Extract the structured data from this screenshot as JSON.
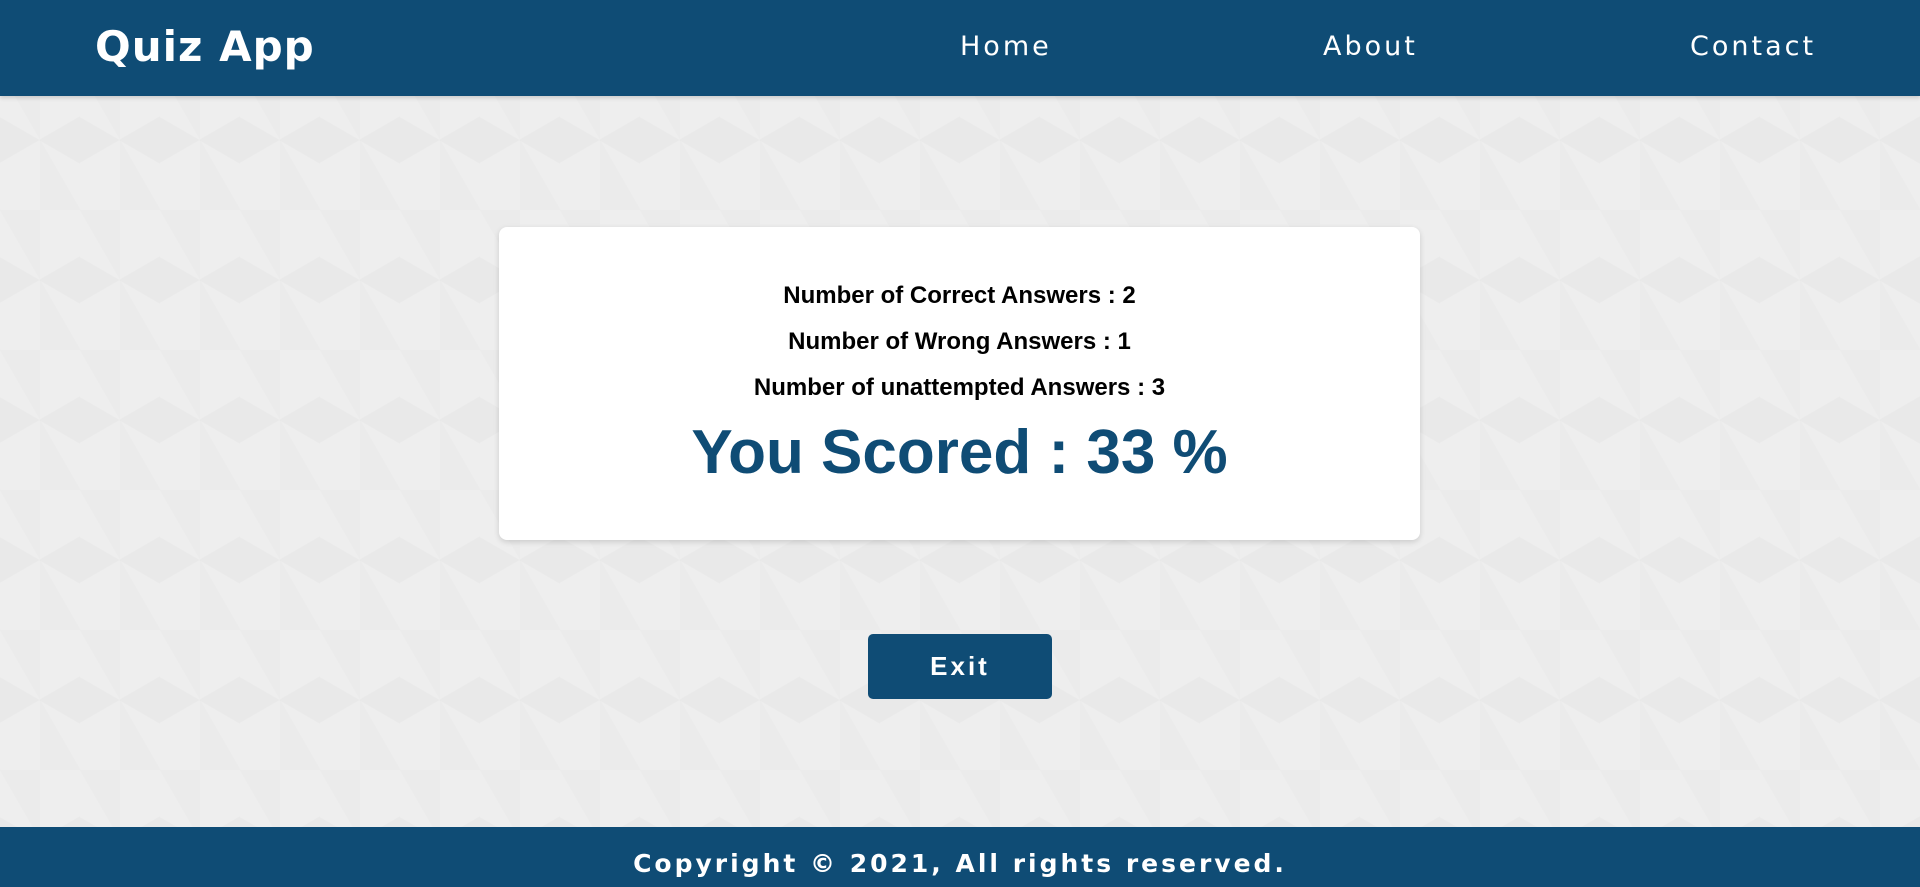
{
  "header": {
    "brand": "Quiz App",
    "nav": {
      "home": "Home",
      "about": "About",
      "contact": "Contact"
    }
  },
  "result": {
    "correct_label": "Number of Correct Answers : 2",
    "wrong_label": "Number of Wrong Answers : 1",
    "unattempted_label": "Number of unattempted Answers : 3",
    "score_label": "You Scored : 33 %"
  },
  "actions": {
    "exit_label": "Exit"
  },
  "footer": {
    "copyright": "Copyright © 2021, All rights reserved."
  },
  "colors": {
    "primary": "#0f4c75",
    "background": "#eeeeee",
    "card": "#ffffff"
  }
}
